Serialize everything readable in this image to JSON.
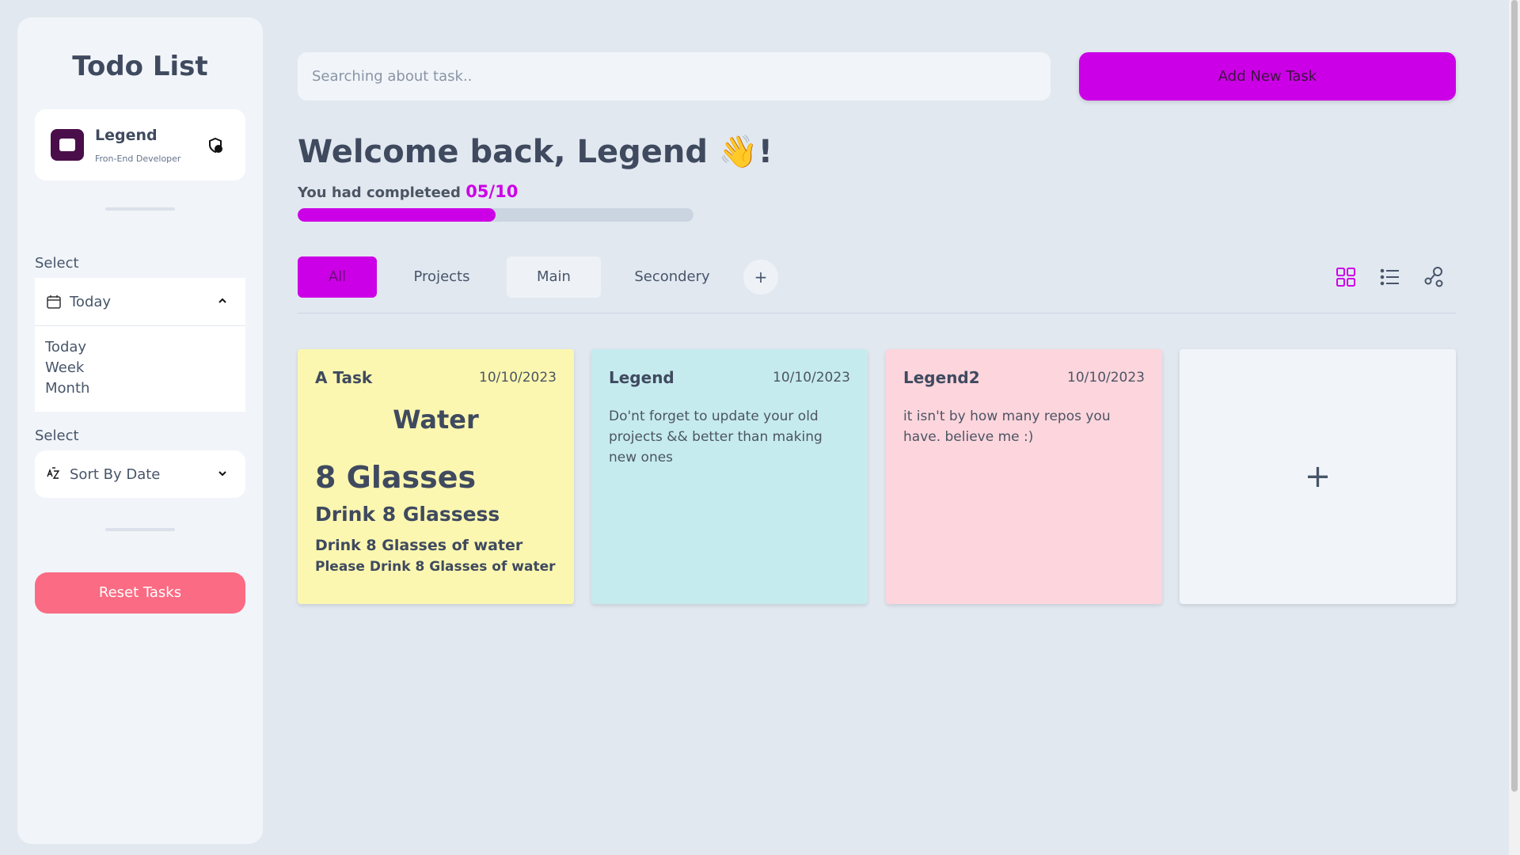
{
  "sidebar": {
    "title": "Todo List",
    "profile": {
      "name": "Legend",
      "role": "Fron-End Developer"
    },
    "period_select": {
      "label": "Select",
      "value": "Today",
      "options": [
        "Today",
        "Week",
        "Month"
      ]
    },
    "sort_select": {
      "label": "Select",
      "value": "Sort By Date"
    },
    "reset_label": "Reset Tasks"
  },
  "header": {
    "search_placeholder": "Searching about task..",
    "add_label": "Add New Task"
  },
  "welcome": {
    "text": "Welcome back, Legend 👋!",
    "completed_label": "You had completeed",
    "completed_count": "05/10",
    "progress": 0.5
  },
  "tabs": [
    {
      "label": "All",
      "active": true
    },
    {
      "label": "Projects"
    },
    {
      "label": "Main"
    },
    {
      "label": "Secondery"
    }
  ],
  "tab_add_label": "+",
  "view_icons": [
    "grid-view-icon",
    "list-view-icon",
    "graph-view-icon"
  ],
  "cards": [
    {
      "title": "A Task",
      "date": "10/10/2023",
      "color": "#fbf7b0",
      "h1": "Water",
      "h2": "8 Glasses",
      "h3": "Drink 8 Glassess",
      "h4": "Drink 8 Glasses of water",
      "h5": "Please Drink 8 Glasses of water"
    },
    {
      "title": "Legend",
      "date": "10/10/2023",
      "color": "#c6ebee",
      "desc": "Do'nt forget to update your old projects && better than making new ones"
    },
    {
      "title": "Legend2",
      "date": "10/10/2023",
      "color": "#fdd5dd",
      "desc": "it isn't by how many repos you have. believe me :)"
    }
  ],
  "add_card_label": "+",
  "colors": {
    "accent": "#cc00e6",
    "reset": "#fb6b83",
    "background": "#e2e8f0"
  }
}
